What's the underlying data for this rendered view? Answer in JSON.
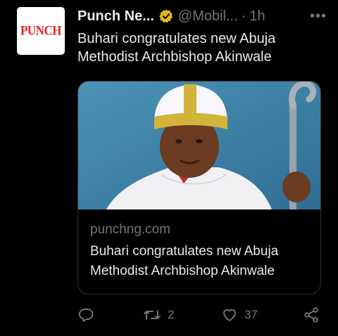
{
  "tweet": {
    "author_name": "Punch Ne...",
    "handle": "@Mobil...",
    "separator": "·",
    "time": "1h",
    "more_label": "•••",
    "text": "Buhari congratulates new Abuja Methodist Archbishop Akinwale"
  },
  "avatar": {
    "logo_text": "PUNCH"
  },
  "card": {
    "domain": "punchng.com",
    "title": "Buhari congratulates new Abuja Methodist Archbishop Akinwale"
  },
  "actions": {
    "replies": "",
    "retweets": "2",
    "likes": "37"
  },
  "colors": {
    "background": "#000000",
    "text": "#e7e9ea",
    "muted": "#71767b",
    "verified_gold": "#e2b719",
    "border": "#2f3336",
    "brand_red": "#e0232f"
  },
  "icons": [
    "verified-gold-badge-icon",
    "more-icon",
    "reply-icon",
    "retweet-icon",
    "like-icon",
    "share-icon"
  ]
}
